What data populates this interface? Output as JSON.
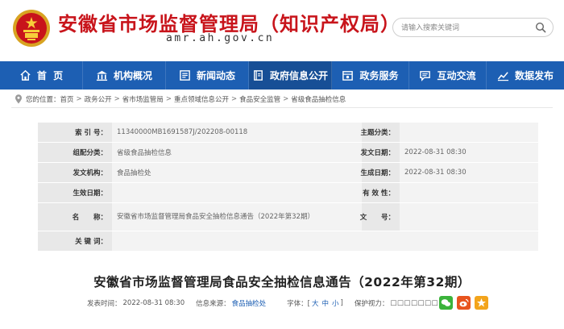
{
  "header": {
    "title": "安徽省市场监督管理局（知识产权局）",
    "domain": "amr.ah.gov.cn",
    "search_placeholder": "请输入搜索关键词"
  },
  "nav": {
    "items": [
      {
        "label": "首  页",
        "icon": "home-icon"
      },
      {
        "label": "机构概况",
        "icon": "building-icon"
      },
      {
        "label": "新闻动态",
        "icon": "news-icon"
      },
      {
        "label": "政府信息公开",
        "icon": "book-icon"
      },
      {
        "label": "政务服务",
        "icon": "stamp-icon"
      },
      {
        "label": "互动交流",
        "icon": "chat-icon"
      },
      {
        "label": "数据发布",
        "icon": "chart-icon"
      }
    ]
  },
  "breadcrumb": {
    "prefix": "您的位置：",
    "items": [
      "首页",
      "政务公开",
      "省市场监管局",
      "重点领域信息公开",
      "食品安全监管",
      "省级食品抽检信息"
    ]
  },
  "meta": {
    "index_label": "索 引 号：",
    "index_value": "11340000MB1691587J/202208-00118",
    "topic_label": "主题分类：",
    "topic_value": "",
    "category_label": "组配分类：",
    "category_value": "省级食品抽检信息",
    "date_label": "发文日期：",
    "date_value": "2022-08-31 08:30",
    "org_label": "发文机构：",
    "org_value": "食品抽检处",
    "gen_date_label": "生成日期：",
    "gen_date_value": "2022-08-31 08:30",
    "effective_label": "生效日期：",
    "effective_value": "",
    "validity_label": "有 效 性：",
    "validity_value": "",
    "name_label": "名      称：",
    "name_value": "安徽省市场监督管理局食品安全抽检信息通告（2022年第32期）",
    "doc_no_label": "文      号：",
    "doc_no_value": "",
    "keywords_label": "关 键 词：",
    "keywords_value": ""
  },
  "article": {
    "title": "安徽省市场监督管理局食品安全抽检信息通告（2022年第32期）",
    "publish_label": "发表时间：",
    "publish_value": "2022-08-31 08:30",
    "source_label": "信息来源：",
    "source_value": "食品抽检处",
    "font_label": "字体：[",
    "font_large": "大",
    "font_medium": "中",
    "font_small": "小",
    "font_end": "]",
    "protect_label": "保护视力：",
    "protect_value": "□□□□□□□□",
    "share_colors": {
      "wechat": "#3bb33b",
      "weibo": "#e8541e",
      "favorite": "#f3a41b"
    }
  },
  "colors": {
    "brand_red": "#c8141b",
    "nav_blue": "#1d5fb3"
  }
}
